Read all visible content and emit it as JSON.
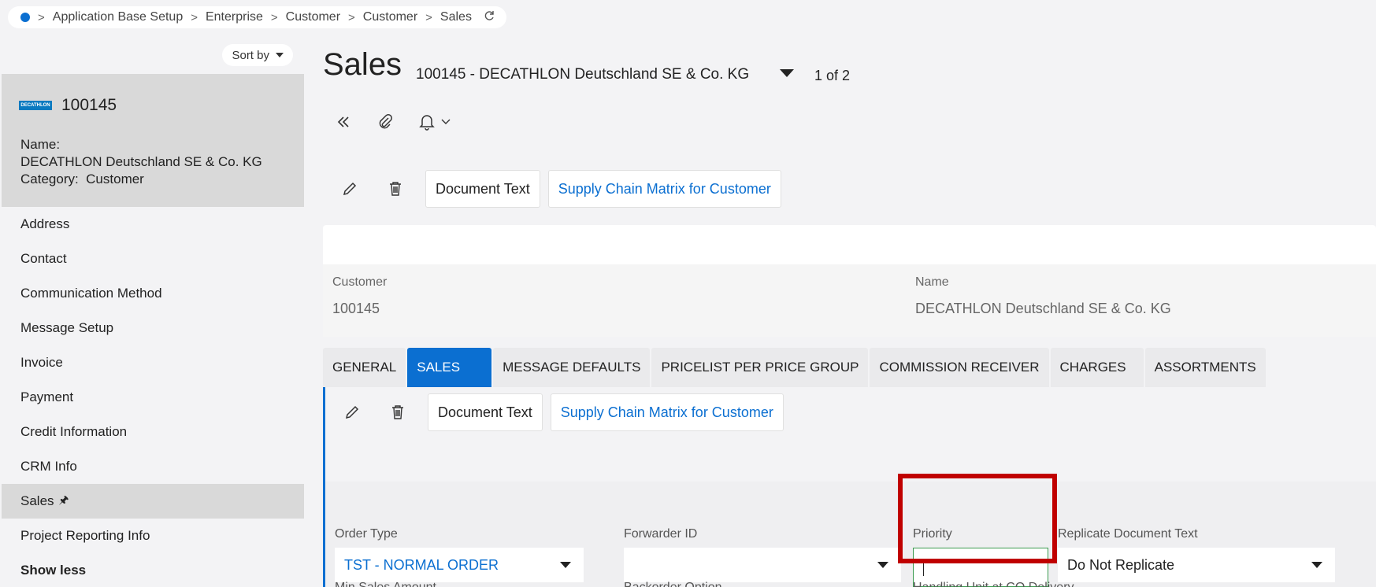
{
  "breadcrumb": {
    "items": [
      "Application Base Setup",
      "Enterprise",
      "Customer",
      "Customer",
      "Sales"
    ]
  },
  "sidebar": {
    "sort_label": "Sort by",
    "record": {
      "logo_text": "DECATHLON",
      "id": "100145",
      "name_label": "Name:",
      "name_value": "DECATHLON Deutschland SE & Co. KG",
      "category_label": "Category:",
      "category_value": "Customer"
    },
    "items": [
      {
        "label": "Address"
      },
      {
        "label": "Contact"
      },
      {
        "label": "Communication Method"
      },
      {
        "label": "Message Setup"
      },
      {
        "label": "Invoice"
      },
      {
        "label": "Payment"
      },
      {
        "label": "Credit Information"
      },
      {
        "label": "CRM Info"
      },
      {
        "label": "Sales"
      },
      {
        "label": "Project Reporting Info"
      },
      {
        "label": "Show less"
      }
    ]
  },
  "page": {
    "title": "Sales",
    "subtitle": "100145 - DECATHLON Deutschland SE & Co. KG",
    "record_count": "1 of 2"
  },
  "toolbar": {
    "document_text": "Document Text",
    "supply_chain": "Supply Chain Matrix for Customer"
  },
  "header": {
    "customer_label": "Customer",
    "customer_value": "100145",
    "name_label": "Name",
    "name_value": "DECATHLON Deutschland SE & Co. KG"
  },
  "tabs": [
    "GENERAL",
    "SALES",
    "MESSAGE DEFAULTS",
    "PRICELIST PER PRICE GROUP",
    "COMMISSION RECEIVER",
    "CHARGES",
    "ASSORTMENTS"
  ],
  "form": {
    "order_type_label": "Order Type",
    "order_type_value": "TST - NORMAL ORDER",
    "forwarder_label": "Forwarder ID",
    "forwarder_value": "",
    "priority_label": "Priority",
    "priority_value": "",
    "replicate_label": "Replicate Document Text",
    "replicate_value": "Do Not Replicate",
    "min_sales_label": "Min Sales Amount",
    "backorder_label": "Backorder Option",
    "handling_label": "Handling Unit at CO Delivery"
  },
  "colors": {
    "accent": "#0b6fd1",
    "highlight": "#c00000",
    "focus_border": "#3a9a4e"
  }
}
